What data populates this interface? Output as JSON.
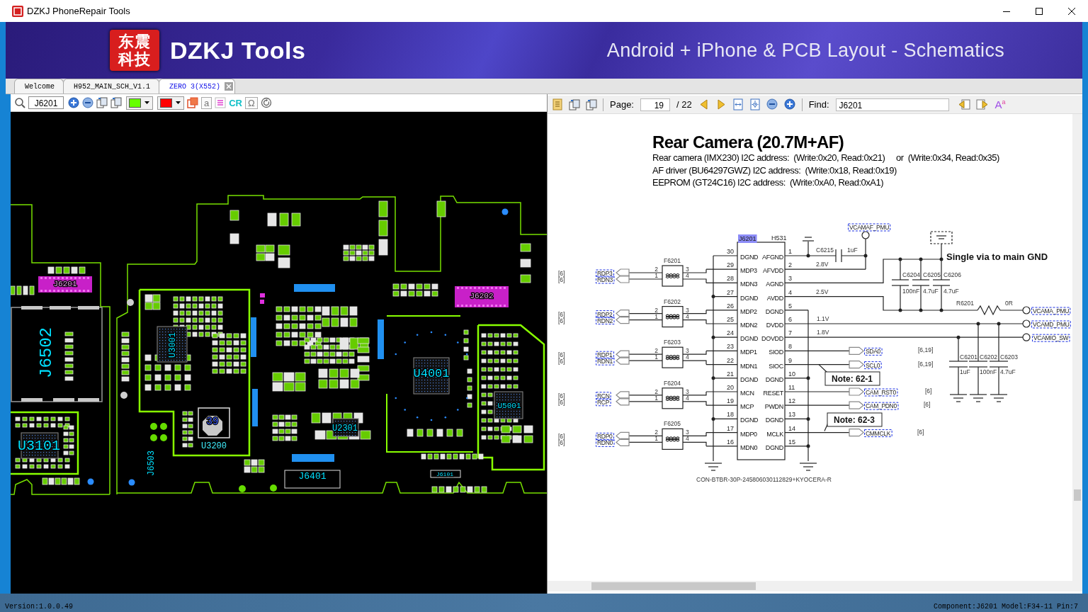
{
  "window": {
    "title": "DZKJ PhoneRepair Tools"
  },
  "banner": {
    "logo_text": [
      "东震",
      "科技"
    ],
    "brand": "DZKJ Tools",
    "tagline": "Android + iPhone & PCB Layout - Schematics"
  },
  "tabs": [
    {
      "label": "Welcome",
      "selected": false,
      "closable": false
    },
    {
      "label": "H952_MAIN_SCH_V1.1",
      "selected": false,
      "closable": false
    },
    {
      "label": "ZERO 3(X552)",
      "selected": true,
      "closable": true
    }
  ],
  "board_toolbar": {
    "items": [
      {
        "kind": "search"
      },
      {
        "kind": "field",
        "value": "J6201"
      },
      {
        "kind": "zoomin"
      },
      {
        "kind": "zoomout"
      },
      {
        "kind": "pages"
      },
      {
        "kind": "pages"
      },
      {
        "kind": "swatch",
        "color": "#66ff00"
      },
      {
        "kind": "swatch",
        "color": "#ff0000"
      },
      {
        "kind": "layers"
      },
      {
        "kind": "letter",
        "text": "a"
      },
      {
        "kind": "list"
      },
      {
        "kind": "text",
        "text": "CR"
      },
      {
        "kind": "letter",
        "text": "Ω"
      },
      {
        "kind": "reset"
      }
    ]
  },
  "pcb": {
    "labels": [
      "J6201",
      "J6202",
      "J6502",
      "U3001",
      "U4001",
      "U5001",
      "U2301",
      "U3101",
      "39",
      "U3200",
      "J6503",
      "J6401",
      "J6101"
    ]
  },
  "viewer_toolbar": {
    "items": [
      {
        "kind": "doc"
      },
      {
        "kind": "pages"
      },
      {
        "kind": "pages"
      },
      {
        "kind": "separator"
      },
      {
        "kind": "label",
        "text": "Page:"
      },
      {
        "kind": "pagefield",
        "value": "19"
      },
      {
        "kind": "label",
        "text": "/ 22"
      },
      {
        "kind": "prev"
      },
      {
        "kind": "next"
      },
      {
        "kind": "fitwidth"
      },
      {
        "kind": "fitpage"
      },
      {
        "kind": "zoomout"
      },
      {
        "kind": "zoomin"
      },
      {
        "kind": "separator"
      },
      {
        "kind": "label",
        "text": "Find:"
      },
      {
        "kind": "findfield",
        "value": "J6201"
      },
      {
        "kind": "findprev"
      },
      {
        "kind": "findnext"
      },
      {
        "kind": "glyph",
        "text": "A$^{a}$"
      }
    ]
  },
  "schematic": {
    "title": "Rear Camera (20.7M+AF)",
    "notes": [
      "Rear camera (IMX230) I2C address:  (Write:0x20, Read:0x21)     or  (Write:0x34, Read:0x35)",
      "AF driver (BU64297GWZ) I2C address:  (Write:0x18, Read:0x19)",
      "EEPROM (GT24C16) I2C address:  (Write:0xA0, Read:0xA1)"
    ],
    "connector": {
      "ref": "J6201",
      "part": "H531",
      "footprint": "CON-BTBR-30P-245806030112829+KYOCERA-R"
    },
    "pins": [
      {
        "left_num": "30",
        "left_name": "DGND",
        "right_name": "AFGND",
        "right_num": "1"
      },
      {
        "left_num": "29",
        "left_name": "MDP3",
        "right_name": "AFVDD",
        "right_num": "2"
      },
      {
        "left_num": "28",
        "left_name": "MDN3",
        "right_name": "AGND",
        "right_num": "3"
      },
      {
        "left_num": "27",
        "left_name": "DGND",
        "right_name": "AVDD",
        "right_num": "4"
      },
      {
        "left_num": "26",
        "left_name": "MDP2",
        "right_name": "DGND",
        "right_num": "5"
      },
      {
        "left_num": "25",
        "left_name": "MDN2",
        "right_name": "DVDD",
        "right_num": "6"
      },
      {
        "left_num": "24",
        "left_name": "DGND",
        "right_name": "DOVDD",
        "right_num": "7"
      },
      {
        "left_num": "23",
        "left_name": "MDP1",
        "right_name": "SIOD",
        "right_num": "8"
      },
      {
        "left_num": "22",
        "left_name": "MDN1",
        "right_name": "SIOC",
        "right_num": "9"
      },
      {
        "left_num": "21",
        "left_name": "DGND",
        "right_name": "DGND",
        "right_num": "10"
      },
      {
        "left_num": "20",
        "left_name": "MCN",
        "right_name": "RESET",
        "right_num": "11"
      },
      {
        "left_num": "19",
        "left_name": "MCP",
        "right_name": "PWDN",
        "right_num": "12"
      },
      {
        "left_num": "18",
        "left_name": "DGND",
        "right_name": "DGND",
        "right_num": "13"
      },
      {
        "left_num": "17",
        "left_name": "MDP0",
        "right_name": "MCLK",
        "right_num": "14"
      },
      {
        "left_num": "16",
        "left_name": "MDN0",
        "right_name": "DGND",
        "right_num": "15"
      }
    ],
    "filters": [
      {
        "ref": "F6201",
        "in_pins": [
          "2",
          "1"
        ],
        "out_pins": [
          "3",
          "4"
        ],
        "nets": [
          "RDP3",
          "RDN3"
        ],
        "sheets": [
          "[6]",
          "[6]"
        ]
      },
      {
        "ref": "F6202",
        "in_pins": [
          "2",
          "1"
        ],
        "out_pins": [
          "3",
          "4"
        ],
        "nets": [
          "RDP2",
          "RDN2"
        ],
        "sheets": [
          "[6]",
          "[6]"
        ]
      },
      {
        "ref": "F6203",
        "in_pins": [
          "2",
          "1"
        ],
        "out_pins": [
          "3",
          "4"
        ],
        "nets": [
          "RDP1",
          "RDN1"
        ],
        "sheets": [
          "[6]",
          "[6]"
        ]
      },
      {
        "ref": "F6204",
        "in_pins": [
          "2",
          "1"
        ],
        "out_pins": [
          "3",
          "4"
        ],
        "nets": [
          "RCN",
          "RCP"
        ],
        "sheets": [
          "[6]",
          "[6]"
        ]
      },
      {
        "ref": "F6205",
        "in_pins": [
          "2",
          "1"
        ],
        "out_pins": [
          "3",
          "4"
        ],
        "nets": [
          "RDP0",
          "RDN0"
        ],
        "sheets": [
          "[6]",
          "[6]"
        ]
      }
    ],
    "supplies": [
      "2.8V",
      "2.5V",
      "1.1V",
      "1.8V"
    ],
    "ports": [
      "VCAMAF_PMU",
      "VCAMA_PMU",
      "VCAMD_PMU",
      "VCAMIO_SW"
    ],
    "capacitors": [
      {
        "ref": "C6215",
        "value": "1uF"
      },
      {
        "ref": "C6204",
        "value": "100nF"
      },
      {
        "ref": "C6205",
        "value": "4.7uF"
      },
      {
        "ref": "C6206",
        "value": "4.7uF"
      },
      {
        "ref": "C6201",
        "value": "1uF"
      },
      {
        "ref": "C6202",
        "value": "100nF"
      },
      {
        "ref": "C6203",
        "value": "4.7uF"
      }
    ],
    "resistor": {
      "ref": "R6201",
      "value": "0R"
    },
    "signals": [
      {
        "name": "SDA0",
        "sheets": "[6,19]"
      },
      {
        "name": "SCL0",
        "sheets": "[6,19]"
      },
      {
        "name": "CAM_RST0",
        "sheets": "[6]"
      },
      {
        "name": "CAM_PDN0",
        "sheets": "[6]"
      },
      {
        "name": "CMMCLK",
        "sheets": "[6]"
      }
    ],
    "callouts": [
      "Note: 62-1",
      "Note: 62-3"
    ],
    "gnd_note": "Single via to main GND"
  },
  "status_bar": {
    "version": "Version:1.0.0.49",
    "component": "Component:J6201 Model:F34-11 Pin:7"
  }
}
